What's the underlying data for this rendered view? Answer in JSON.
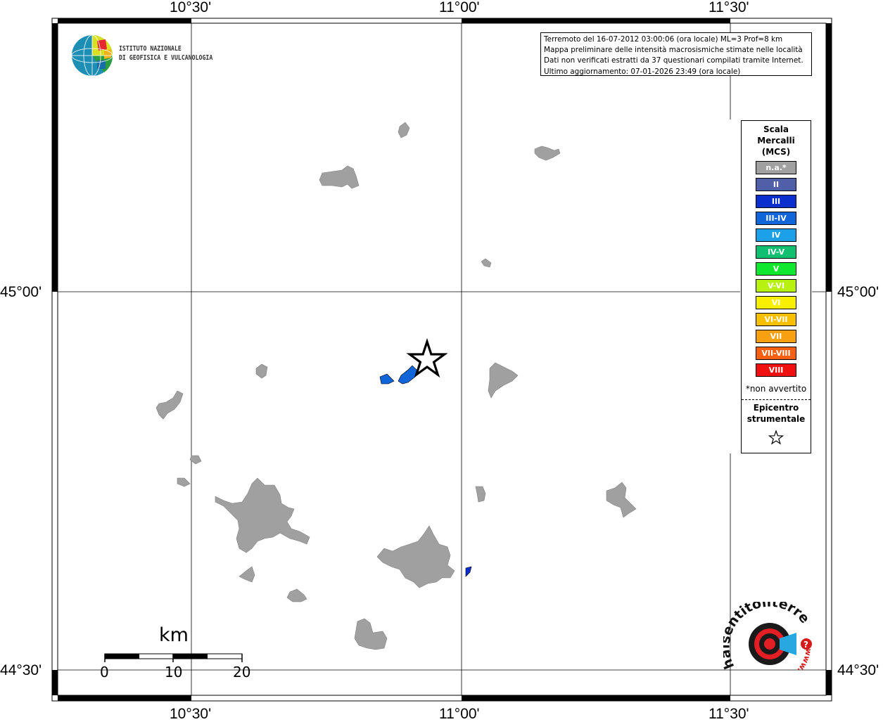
{
  "map": {
    "lon_ticks_top": [
      "10°30'",
      "11°00'",
      "11°30'"
    ],
    "lon_ticks_bottom": [
      "10°30'",
      "11°00'",
      "11°30'"
    ],
    "lat_ticks_left": [
      "45°00'",
      "44°30'"
    ],
    "lat_ticks_right": [
      "45°00'",
      "44°30'"
    ]
  },
  "org": {
    "line1": "ISTITUTO NAZIONALE",
    "line2": "DI GEOFISICA E VULCANOLOGIA"
  },
  "info": {
    "line1": "Terremoto del 16-07-2012 03:00:06 (ora locale) ML=3 Prof=8 km",
    "line2": "Mappa preliminare delle intensità macrosismiche stimate nelle località",
    "line3": "Dati non verificati estratti da 37 questionari compilati tramite Internet.",
    "line4": "Ultimo aggiornamento: 07-01-2026 23:49 (ora locale)"
  },
  "legend": {
    "title1": "Scala",
    "title2": "Mercalli",
    "title3": "(MCS)",
    "items": [
      {
        "label": "n.a.*",
        "color": "#a0a0a0"
      },
      {
        "label": "II",
        "color": "#5060a8"
      },
      {
        "label": "III",
        "color": "#0a2fcc"
      },
      {
        "label": "III-IV",
        "color": "#1065d8"
      },
      {
        "label": "IV",
        "color": "#1ca0e8"
      },
      {
        "label": "IV-V",
        "color": "#10c070"
      },
      {
        "label": "V",
        "color": "#10e830"
      },
      {
        "label": "V-VI",
        "color": "#b8f010"
      },
      {
        "label": "VI",
        "color": "#f8f000"
      },
      {
        "label": "VI-VII",
        "color": "#f8c000"
      },
      {
        "label": "VII",
        "color": "#f8a010"
      },
      {
        "label": "VII-VIII",
        "color": "#f86010"
      },
      {
        "label": "VIII",
        "color": "#f01010"
      }
    ],
    "note": "*non avvertito",
    "epicenter1": "Epicentro",
    "epicenter2": "strumentale"
  },
  "scale_bar": {
    "unit": "km",
    "labels": [
      "0",
      "10",
      "20"
    ]
  },
  "brand": {
    "text": "haisentitoilterremoto.it",
    "prefix": "www."
  }
}
